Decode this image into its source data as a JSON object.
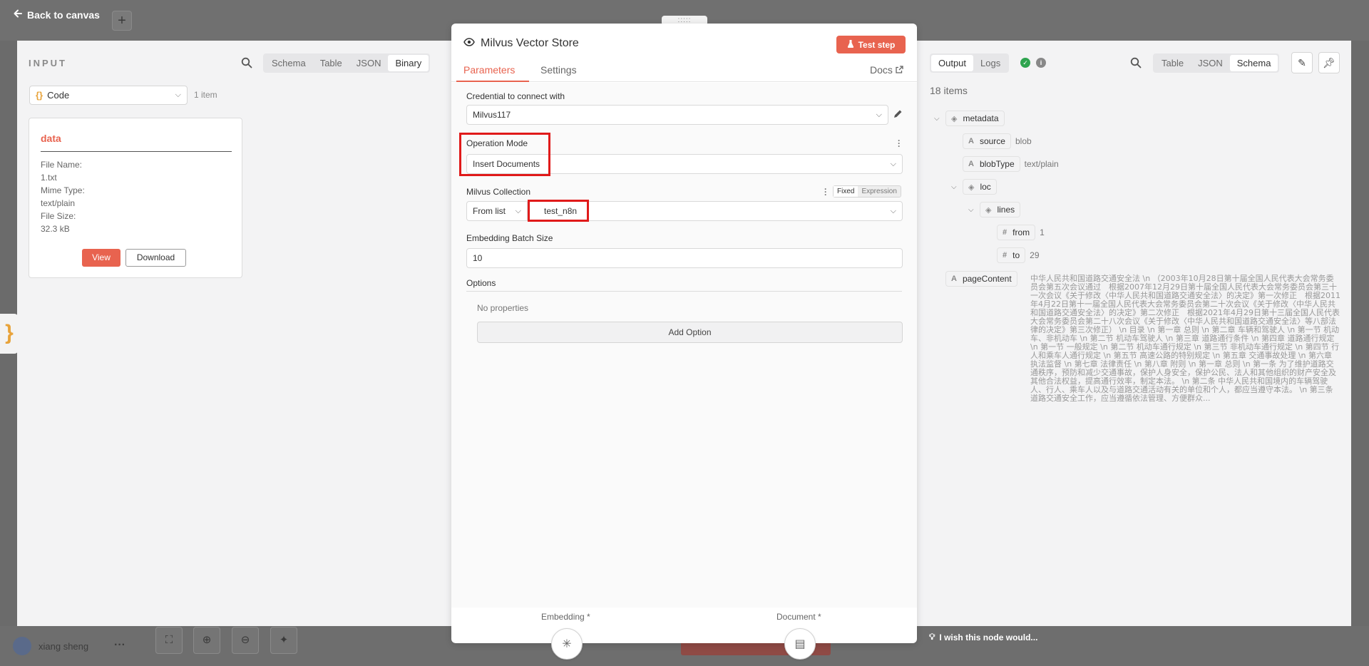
{
  "background": {
    "back_link": "Back to canvas",
    "user_name": "xiang sheng",
    "brace_icon": "}"
  },
  "input": {
    "title": "INPUT",
    "view_tabs": [
      "Schema",
      "Table",
      "JSON",
      "Binary"
    ],
    "active_tab": "Binary",
    "node_select": "Code",
    "item_count": "1 item",
    "binary": {
      "title": "data",
      "file_name_label": "File Name:",
      "file_name": "1.txt",
      "mime_type_label": "Mime Type:",
      "mime_type": "text/plain",
      "file_size_label": "File Size:",
      "file_size": "32.3 kB",
      "view_label": "View",
      "download_label": "Download"
    }
  },
  "node": {
    "title": "Milvus Vector Store",
    "test_step_label": "Test step",
    "tabs": [
      "Parameters",
      "Settings"
    ],
    "active_tab": "Parameters",
    "docs_label": "Docs",
    "credential_label": "Credential to connect with",
    "credential_value": "Milvus117",
    "operation_mode_label": "Operation Mode",
    "operation_mode_value": "Insert Documents",
    "collection_label": "Milvus Collection",
    "collection_mode_options": [
      "Fixed",
      "Expression"
    ],
    "collection_source": "From list",
    "collection_value": "test_n8n",
    "batch_size_label": "Embedding Batch Size",
    "batch_size_value": "10",
    "options_label": "Options",
    "no_properties": "No properties",
    "add_option_label": "Add Option",
    "sub_nodes": [
      "Embedding *",
      "Document *"
    ]
  },
  "output": {
    "tabs": [
      "Output",
      "Logs"
    ],
    "active_tab": "Output",
    "view_tabs": [
      "Table",
      "JSON",
      "Schema"
    ],
    "active_view": "Schema",
    "items_count": "18 items",
    "schema": {
      "metadata": "metadata",
      "source_key": "source",
      "source_val": "blob",
      "blobtype_key": "blobType",
      "blobtype_val": "text/plain",
      "loc": "loc",
      "lines": "lines",
      "from_key": "from",
      "from_val": "1",
      "to_key": "to",
      "to_val": "29",
      "pagecontent_key": "pageContent",
      "pagecontent_val": "中华人民共和国道路交通安全法 \\n （2003年10月28日第十届全国人民代表大会常务委员会第五次会议通过　根据2007年12月29日第十届全国人民代表大会常务委员会第三十一次会议《关于修改〈中华人民共和国道路交通安全法〉的决定》第一次修正　根据2011年4月22日第十一届全国人民代表大会常务委员会第二十次会议《关于修改〈中华人民共和国道路交通安全法〉的决定》第二次修正　根据2021年4月29日第十三届全国人民代表大会常务委员会第二十八次会议《关于修改〈中华人民共和国道路交通安全法〉等八部法律的决定》第三次修正） \\n 目录 \\n 第一章 总则 \\n 第二章 车辆和驾驶人 \\n 第一节 机动车、非机动车 \\n 第二节 机动车驾驶人 \\n 第三章 道路通行条件 \\n 第四章 道路通行规定 \\n 第一节 一般规定 \\n 第二节 机动车通行规定 \\n 第三节 非机动车通行规定 \\n 第四节 行人和乘车人通行规定 \\n 第五节 高速公路的特别规定 \\n 第五章 交通事故处理 \\n 第六章 执法监督 \\n 第七章 法律责任 \\n 第八章 附则 \\n 第一章 总则 \\n 第一条 为了维护道路交通秩序，预防和减少交通事故，保护人身安全，保护公民、法人和其他组织的财产安全及其他合法权益，提高通行效率，制定本法。 \\n 第二条 中华人民共和国境内的车辆驾驶人、行人、乘车人以及与道路交通活动有关的单位和个人，都应当遵守本法。 \\n 第三条 道路交通安全工作，应当遵循依法管理、方便群众..."
    },
    "wish_label": "I wish this node would..."
  },
  "colors": {
    "accent": "#e8634f",
    "highlight": "#e01a1a",
    "success": "#2ea44f"
  }
}
